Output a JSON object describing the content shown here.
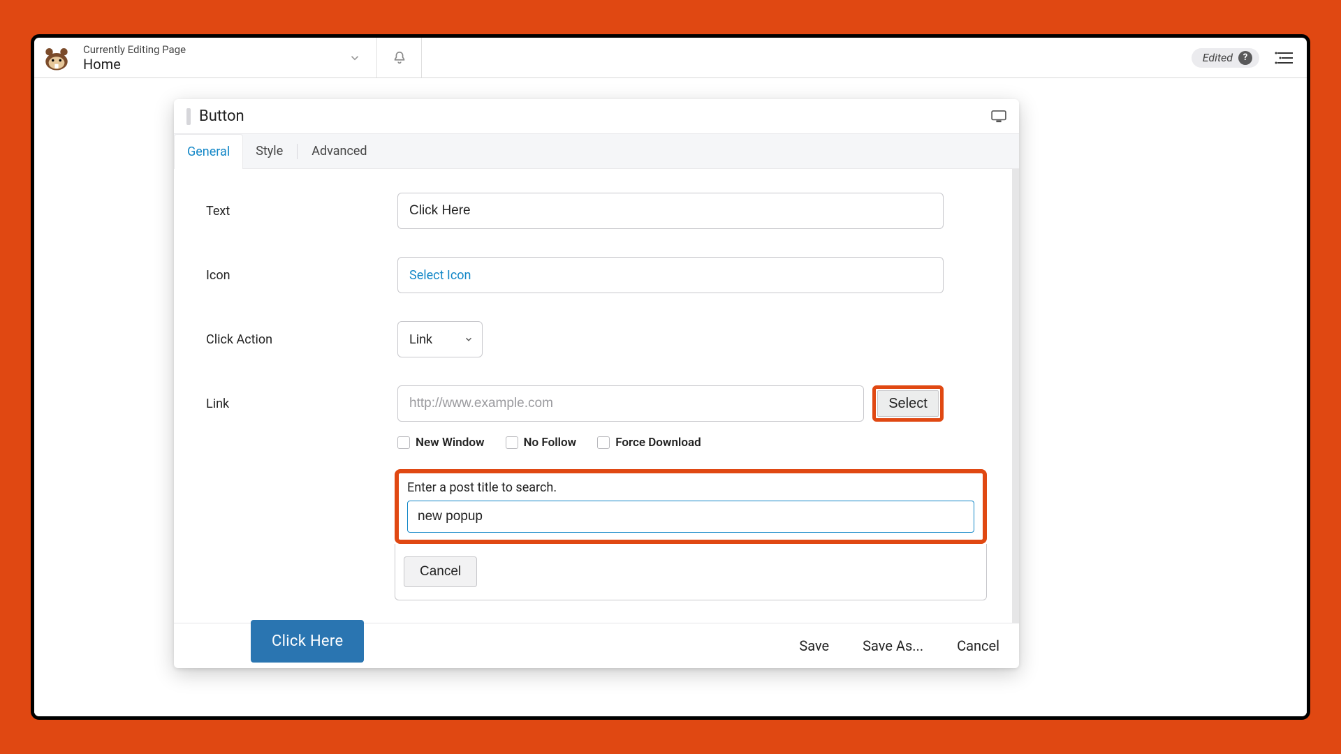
{
  "topbar": {
    "eyebrow": "Currently Editing Page",
    "page_name": "Home",
    "edited_label": "Edited"
  },
  "panel": {
    "title": "Button",
    "tabs": {
      "general": "General",
      "style": "Style",
      "advanced": "Advanced"
    },
    "fields": {
      "text_label": "Text",
      "text_value": "Click Here",
      "icon_label": "Icon",
      "icon_select_text": "Select Icon",
      "click_action_label": "Click Action",
      "click_action_value": "Link",
      "link_label": "Link",
      "link_placeholder": "http://www.example.com",
      "link_value": "",
      "link_select_btn": "Select",
      "new_window": "New Window",
      "no_follow": "No Follow",
      "force_download": "Force Download"
    },
    "search": {
      "label": "Enter a post title to search.",
      "value": "new popup",
      "cancel": "Cancel"
    },
    "footer": {
      "save": "Save",
      "save_as": "Save As...",
      "cancel": "Cancel"
    }
  },
  "preview": {
    "button_text": "Click Here"
  }
}
